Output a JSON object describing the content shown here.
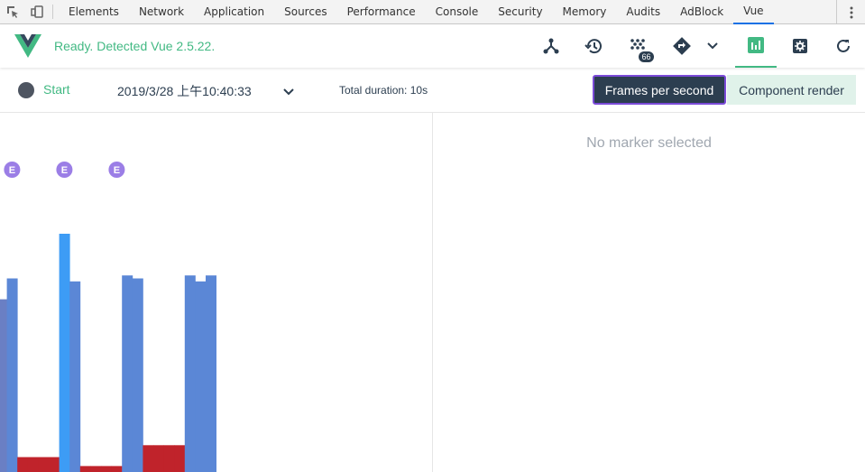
{
  "devtools": {
    "tabs": [
      {
        "label": "Elements",
        "active": false
      },
      {
        "label": "Network",
        "active": false
      },
      {
        "label": "Application",
        "active": false
      },
      {
        "label": "Sources",
        "active": false
      },
      {
        "label": "Performance",
        "active": false
      },
      {
        "label": "Console",
        "active": false
      },
      {
        "label": "Security",
        "active": false
      },
      {
        "label": "Memory",
        "active": false
      },
      {
        "label": "Audits",
        "active": false
      },
      {
        "label": "AdBlock",
        "active": false
      },
      {
        "label": "Vue",
        "active": true
      }
    ]
  },
  "header": {
    "status": "Ready. Detected Vue 2.5.22.",
    "badge_count": "66",
    "brand_color": "#42b983",
    "dark_color": "#2c3e50",
    "icons": [
      "components-icon",
      "history-icon",
      "vuex-icon",
      "router-icon",
      "chevron-down-icon",
      "performance-icon",
      "settings-icon",
      "refresh-icon"
    ]
  },
  "toolbar": {
    "start_label": "Start",
    "recording_timestamp": "2019/3/28 上午10:40:33",
    "duration": "Total duration: 10s",
    "fps_tab": "Frames per second",
    "component_render_tab": "Component render"
  },
  "details": {
    "empty": "No marker selected"
  },
  "chart_data": {
    "type": "bar",
    "metric": "fps",
    "ylim": [
      0,
      100
    ],
    "markers": [
      {
        "label": "E",
        "frame": 1
      },
      {
        "label": "E",
        "frame": 6
      },
      {
        "label": "E",
        "frame": 11
      }
    ],
    "values": [
      58,
      65,
      5,
      5,
      5,
      5,
      80,
      64,
      2,
      2,
      2,
      2,
      66,
      65,
      9,
      9,
      9,
      9,
      66,
      64,
      66
    ]
  }
}
